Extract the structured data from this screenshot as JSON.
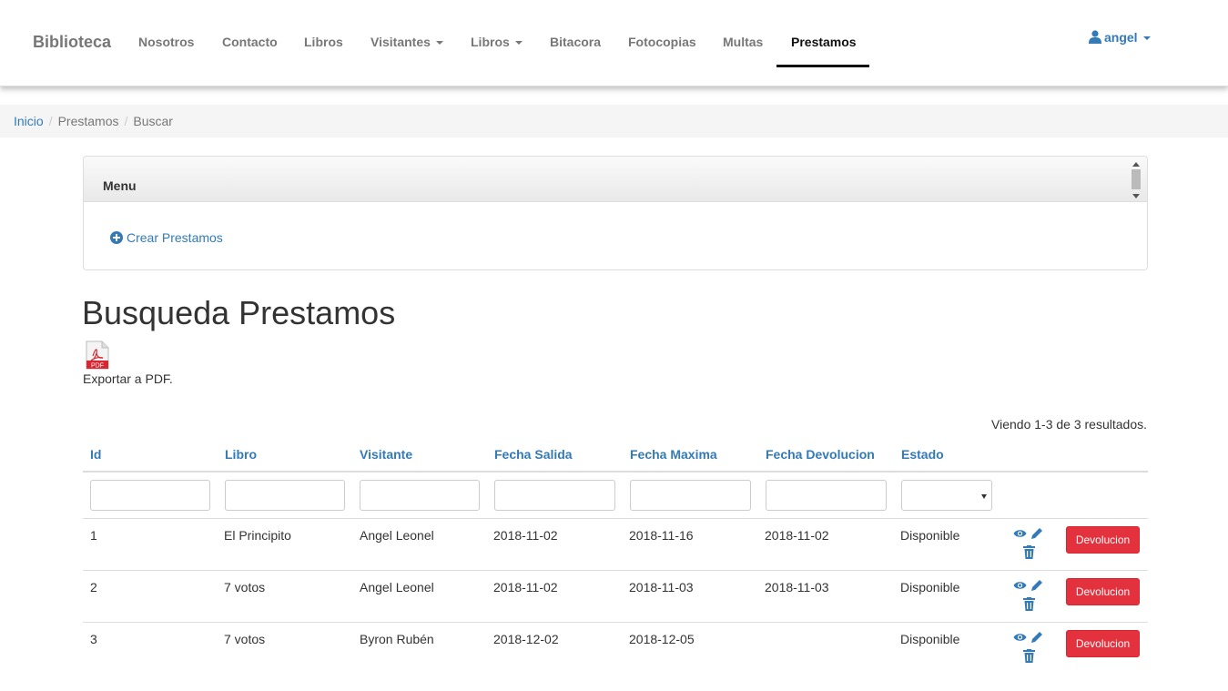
{
  "navbar": {
    "brand": "Biblioteca",
    "items": [
      {
        "label": "Nosotros"
      },
      {
        "label": "Contacto"
      },
      {
        "label": "Libros"
      },
      {
        "label": "Visitantes"
      },
      {
        "label": "Libros"
      },
      {
        "label": "Bitacora"
      },
      {
        "label": "Fotocopias"
      },
      {
        "label": "Multas"
      },
      {
        "label": "Prestamos"
      }
    ],
    "user": "angel"
  },
  "breadcrumb": [
    "Inicio",
    "Prestamos",
    "Buscar"
  ],
  "menu_panel": {
    "title": "Menu",
    "create_link": "Crear Prestamos"
  },
  "page_title": "Busqueda Prestamos",
  "pdf": {
    "icon_text": "PDF",
    "label": "Exportar a PDF."
  },
  "summary": "Viendo 1-3 de 3 resultados.",
  "table": {
    "columns": [
      "Id",
      "Libro",
      "Visitante",
      "Fecha Salida",
      "Fecha Maxima",
      "Fecha Devolucion",
      "Estado"
    ],
    "action_label": "Devolucion",
    "rows": [
      {
        "id": "1",
        "libro": "El Principito",
        "visitante": "Angel Leonel",
        "fecha_salida": "2018-11-02",
        "fecha_maxima": "2018-11-16",
        "fecha_devolucion": "2018-11-02",
        "estado": "Disponible"
      },
      {
        "id": "2",
        "libro": "7 votos",
        "visitante": "Angel Leonel",
        "fecha_salida": "2018-11-02",
        "fecha_maxima": "2018-11-03",
        "fecha_devolucion": "2018-11-03",
        "estado": "Disponible"
      },
      {
        "id": "3",
        "libro": "7 votos",
        "visitante": "Byron Rubén",
        "fecha_salida": "2018-12-02",
        "fecha_maxima": "2018-12-05",
        "fecha_devolucion": "",
        "estado": "Disponible"
      }
    ]
  }
}
